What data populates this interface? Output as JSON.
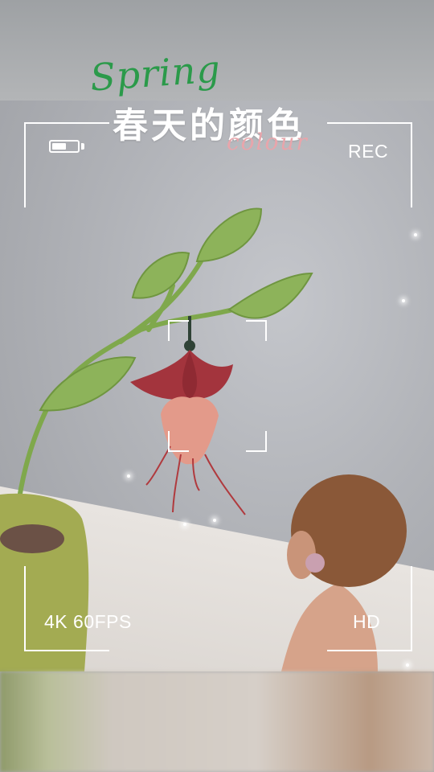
{
  "title": {
    "english": "Spring",
    "chinese": "春天的颜色",
    "subtitle": "colour"
  },
  "camera_hud": {
    "battery_icon": "battery-icon",
    "battery_level": 0.55,
    "rec_label": "REC",
    "resolution_label": "4K 60FPS",
    "quality_label": "HD"
  },
  "colors": {
    "spring_text": "#2b9a4a",
    "colour_text": "#e8a5ab",
    "hud": "#ffffff",
    "flower_red": "#a3343d",
    "flower_pink": "#e39a8a",
    "leaf_green": "#8db35a"
  }
}
